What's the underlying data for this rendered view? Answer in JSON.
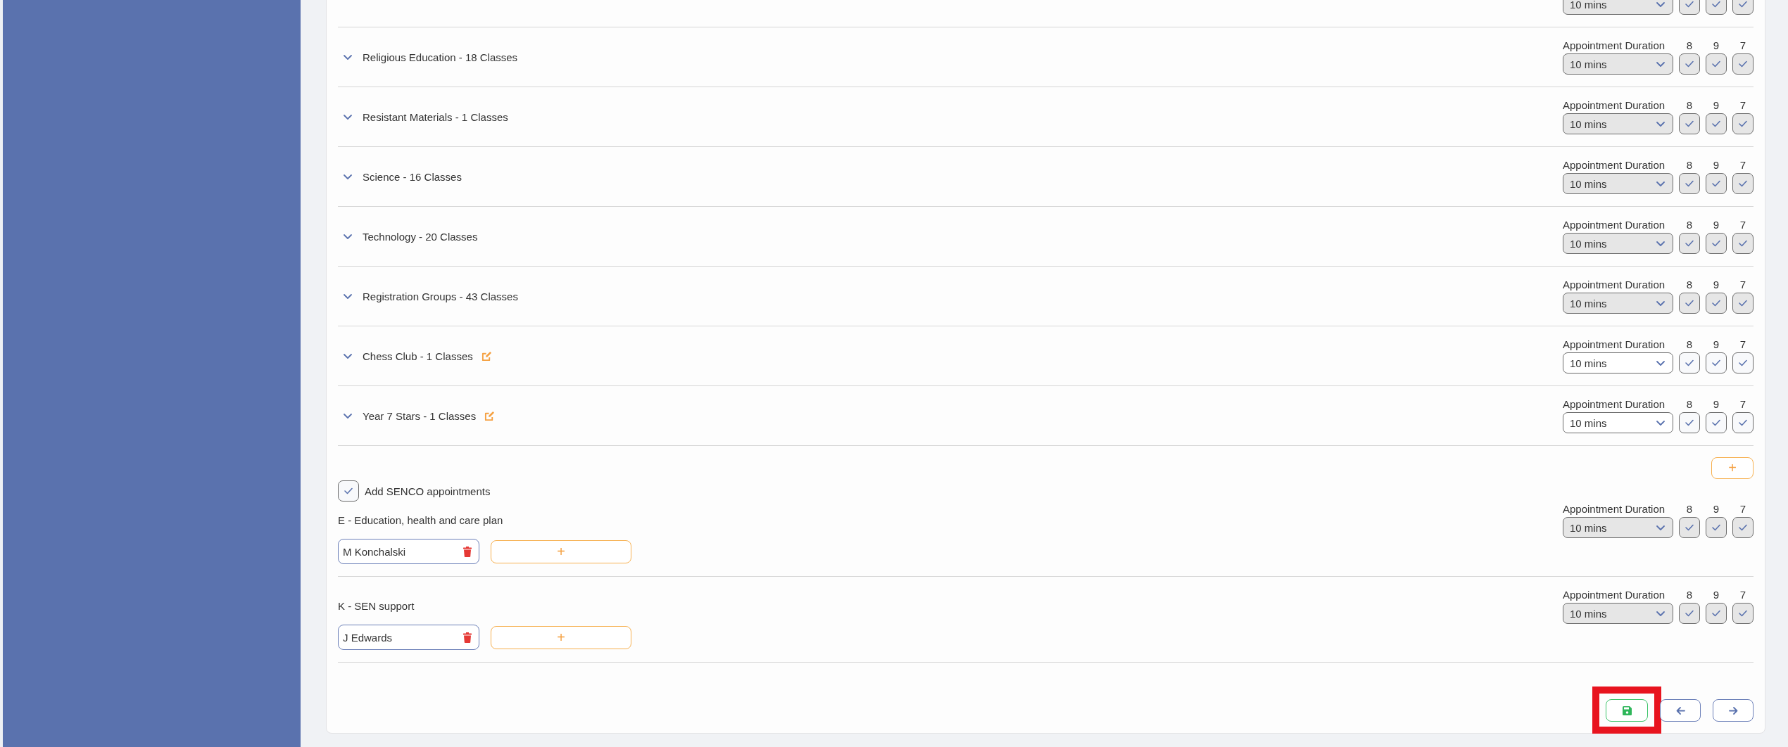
{
  "subjects": [
    {
      "disabled": true,
      "duration": {
        "value": "10 mins"
      },
      "years": [
        {
          "checked": true
        },
        {
          "checked": true
        },
        {
          "checked": true
        }
      ]
    },
    {
      "title": "Religious Education - 18 Classes",
      "editable": false,
      "disabled": true,
      "duration": {
        "label": "Appointment Duration",
        "value": "10 mins"
      },
      "years": [
        {
          "label": "8",
          "checked": true
        },
        {
          "label": "9",
          "checked": true
        },
        {
          "label": "7",
          "checked": true
        }
      ]
    },
    {
      "title": "Resistant Materials - 1 Classes",
      "editable": false,
      "disabled": true,
      "duration": {
        "label": "Appointment Duration",
        "value": "10 mins"
      },
      "years": [
        {
          "label": "8",
          "checked": true
        },
        {
          "label": "9",
          "checked": true
        },
        {
          "label": "7",
          "checked": true
        }
      ]
    },
    {
      "title": "Science - 16 Classes",
      "editable": false,
      "disabled": true,
      "duration": {
        "label": "Appointment Duration",
        "value": "10 mins"
      },
      "years": [
        {
          "label": "8",
          "checked": true
        },
        {
          "label": "9",
          "checked": true
        },
        {
          "label": "7",
          "checked": true
        }
      ]
    },
    {
      "title": "Technology - 20 Classes",
      "editable": false,
      "disabled": true,
      "duration": {
        "label": "Appointment Duration",
        "value": "10 mins"
      },
      "years": [
        {
          "label": "8",
          "checked": true
        },
        {
          "label": "9",
          "checked": true
        },
        {
          "label": "7",
          "checked": true
        }
      ]
    },
    {
      "title": "Registration Groups - 43 Classes",
      "editable": false,
      "disabled": true,
      "duration": {
        "label": "Appointment Duration",
        "value": "10 mins"
      },
      "years": [
        {
          "label": "8",
          "checked": true
        },
        {
          "label": "9",
          "checked": true
        },
        {
          "label": "7",
          "checked": true
        }
      ]
    },
    {
      "title": "Chess Club - 1 Classes",
      "editable": true,
      "disabled": false,
      "duration": {
        "label": "Appointment Duration",
        "value": "10 mins"
      },
      "years": [
        {
          "label": "8",
          "checked": true
        },
        {
          "label": "9",
          "checked": true
        },
        {
          "label": "7",
          "checked": true
        }
      ]
    },
    {
      "title": "Year 7 Stars - 1 Classes",
      "editable": true,
      "disabled": false,
      "duration": {
        "label": "Appointment Duration",
        "value": "10 mins"
      },
      "years": [
        {
          "label": "8",
          "checked": true
        },
        {
          "label": "9",
          "checked": true
        },
        {
          "label": "7",
          "checked": true
        }
      ]
    }
  ],
  "senco": {
    "add_button": "+",
    "checkbox": {
      "label": "Add SENCO appointments",
      "checked": true
    },
    "groups": [
      {
        "title": "E - Education, health and care plan",
        "staff": [
          "M Konchalski"
        ],
        "add_staff": "+",
        "disabled": true,
        "duration": {
          "label": "Appointment Duration",
          "value": "10 mins"
        },
        "years": [
          {
            "label": "8",
            "checked": true
          },
          {
            "label": "9",
            "checked": true
          },
          {
            "label": "7",
            "checked": true
          }
        ]
      },
      {
        "title": "K - SEN support",
        "staff": [
          "J Edwards"
        ],
        "add_staff": "+",
        "disabled": true,
        "duration": {
          "label": "Appointment Duration",
          "value": "10 mins"
        },
        "years": [
          {
            "label": "8",
            "checked": true
          },
          {
            "label": "9",
            "checked": true
          },
          {
            "label": "7",
            "checked": true
          }
        ]
      }
    ]
  },
  "footer": {
    "buttons": [
      {
        "kind": "save",
        "highlighted": true
      },
      {
        "kind": "back",
        "highlighted": false
      },
      {
        "kind": "next",
        "highlighted": false
      }
    ]
  }
}
